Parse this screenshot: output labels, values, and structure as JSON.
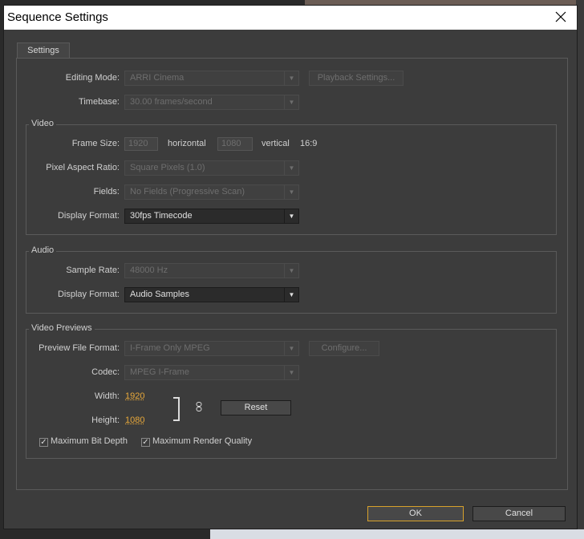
{
  "window": {
    "title": "Sequence Settings"
  },
  "tabs": [
    {
      "label": "Settings"
    }
  ],
  "general": {
    "editing_mode": {
      "label": "Editing Mode:",
      "value": "ARRI Cinema"
    },
    "playback_settings_button": "Playback Settings...",
    "timebase": {
      "label": "Timebase:",
      "value": "30.00 frames/second"
    }
  },
  "video": {
    "title": "Video",
    "frame_size": {
      "label": "Frame Size:",
      "horizontal_value": "1920",
      "horizontal_label": "horizontal",
      "vertical_value": "1080",
      "vertical_label": "vertical",
      "aspect": "16:9"
    },
    "pixel_aspect_ratio": {
      "label": "Pixel Aspect Ratio:",
      "value": "Square Pixels (1.0)"
    },
    "fields": {
      "label": "Fields:",
      "value": "No Fields (Progressive Scan)"
    },
    "display_format": {
      "label": "Display Format:",
      "value": "30fps Timecode"
    }
  },
  "audio": {
    "title": "Audio",
    "sample_rate": {
      "label": "Sample Rate:",
      "value": "48000 Hz"
    },
    "display_format": {
      "label": "Display Format:",
      "value": "Audio Samples"
    }
  },
  "video_previews": {
    "title": "Video Previews",
    "preview_file_format": {
      "label": "Preview File Format:",
      "value": "I-Frame Only MPEG"
    },
    "configure_button": "Configure...",
    "codec": {
      "label": "Codec:",
      "value": "MPEG I-Frame"
    },
    "width": {
      "label": "Width:",
      "value": "1920"
    },
    "height": {
      "label": "Height:",
      "value": "1080"
    },
    "reset_button": "Reset",
    "max_bit_depth": {
      "label": "Maximum Bit Depth",
      "checked": true
    },
    "max_render_quality": {
      "label": "Maximum Render Quality",
      "checked": true
    }
  },
  "footer": {
    "ok_label": "OK",
    "cancel_label": "Cancel"
  },
  "colors": {
    "accent": "#d8a22b",
    "value_link": "#e8a83a",
    "dialog_bg": "#3c3c3c"
  }
}
